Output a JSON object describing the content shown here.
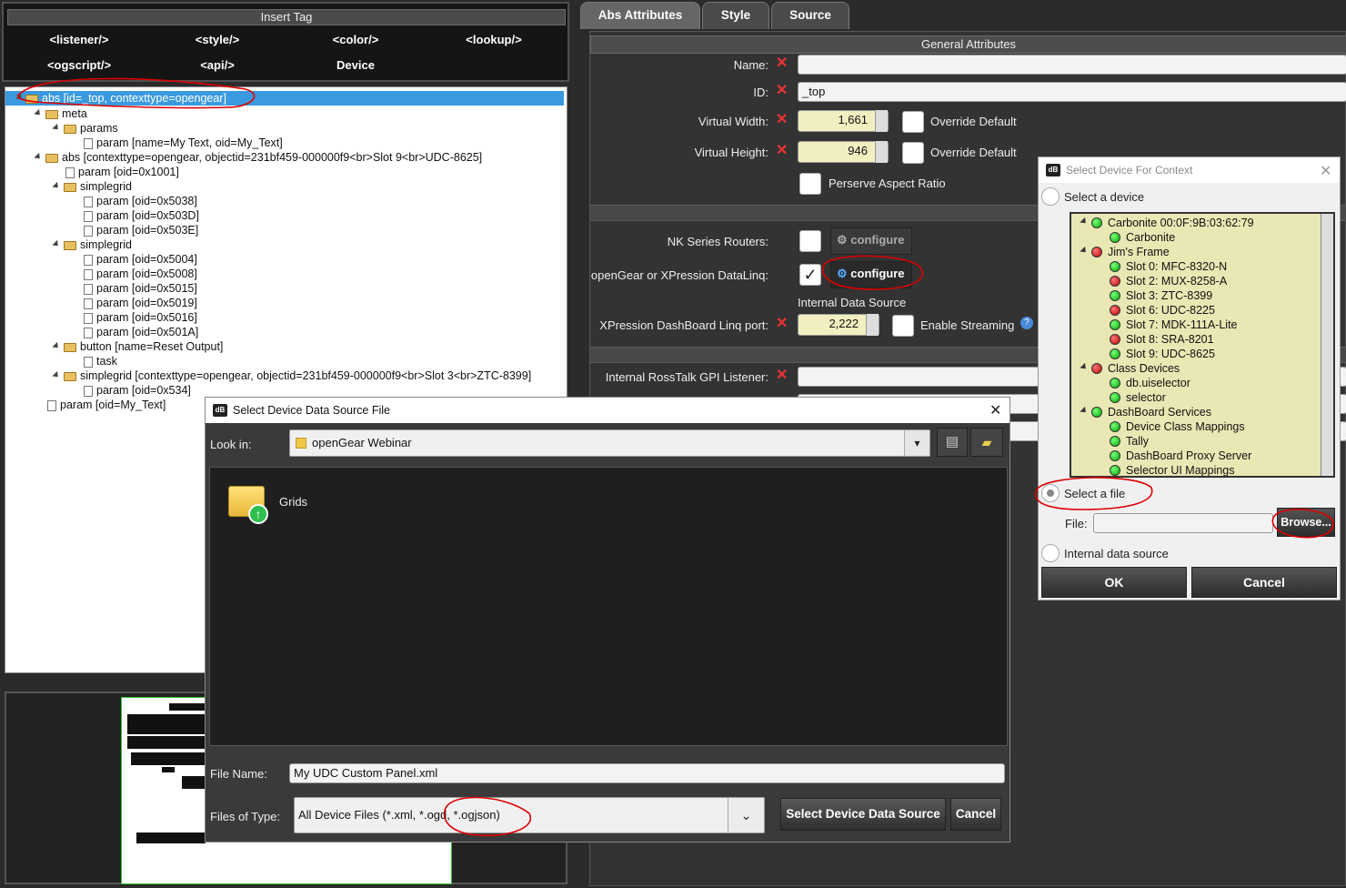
{
  "insert_tag": {
    "title": "Insert Tag",
    "buttons": [
      "<listener/>",
      "<style/>",
      "<color/>",
      "<lookup/>",
      "<ogscript/>",
      "<api/>",
      "Device"
    ]
  },
  "tree": {
    "nodes": [
      "abs [id=_top, contexttype=opengear]",
      "meta",
      "params",
      "param [name=My Text, oid=My_Text]",
      "abs [contexttype=opengear, objectid=231bf459-000000f9<br>Slot 9<br>UDC-8625]",
      "param [oid=0x1001]",
      "simplegrid",
      "param [oid=0x5038]",
      "param [oid=0x503D]",
      "param [oid=0x503E]",
      "simplegrid",
      "param [oid=0x5004]",
      "param [oid=0x5008]",
      "param [oid=0x5015]",
      "param [oid=0x5019]",
      "param [oid=0x5016]",
      "param [oid=0x501A]",
      "button [name=Reset Output]",
      "task",
      "simplegrid [contexttype=opengear, objectid=231bf459-000000f9<br>Slot 3<br>ZTC-8399]",
      "param [oid=0x534]",
      "param [oid=My_Text]"
    ]
  },
  "tabs": [
    "Abs Attributes",
    "Style",
    "Source"
  ],
  "general": {
    "title": "General Attributes",
    "name_label": "Name:",
    "name_value": "",
    "id_label": "ID:",
    "id_value": "_top",
    "vwidth_label": "Virtual Width:",
    "vwidth_value": "1,661",
    "vheight_label": "Virtual Height:",
    "vheight_value": "946",
    "override_label": "Override Default",
    "aspect_label": "Perserve Aspect Ratio",
    "nk_label": "NK Series Routers:",
    "configure": "configure",
    "datalinq_label": "openGear or XPression DataLinq:",
    "internal_source": "Internal Data Source",
    "xpression_label": "XPression DashBoard Linq port:",
    "xpression_value": "2,222",
    "streaming_label": "Enable Streaming",
    "rosstalk_label": "Internal RossTalk GPI Listener:"
  },
  "device_dialog": {
    "title": "Select Device For Context",
    "select_device": "Select a device",
    "devices": [
      {
        "label": "Carbonite 00:0F:9B:03:62:79",
        "status": "green"
      },
      {
        "label": "Carbonite",
        "status": "green"
      },
      {
        "label": "Jim's Frame",
        "status": "red"
      },
      {
        "label": "Slot 0: MFC-8320-N",
        "status": "green"
      },
      {
        "label": "Slot 2: MUX-8258-A",
        "status": "red"
      },
      {
        "label": "Slot 3: ZTC-8399",
        "status": "green"
      },
      {
        "label": "Slot 6: UDC-8225",
        "status": "red"
      },
      {
        "label": "Slot 7: MDK-111A-Lite",
        "status": "green"
      },
      {
        "label": "Slot 8: SRA-8201",
        "status": "red"
      },
      {
        "label": "Slot 9: UDC-8625",
        "status": "green"
      },
      {
        "label": "Class Devices",
        "status": "red"
      },
      {
        "label": "db.uiselector",
        "status": "green"
      },
      {
        "label": "selector",
        "status": "green"
      },
      {
        "label": "DashBoard Services",
        "status": "green"
      },
      {
        "label": "Device Class Mappings",
        "status": "green"
      },
      {
        "label": "Tally",
        "status": "green"
      },
      {
        "label": "DashBoard Proxy Server",
        "status": "green"
      },
      {
        "label": "Selector UI Mappings",
        "status": "green"
      }
    ],
    "select_file": "Select a file",
    "file_label": "File:",
    "file_value": "",
    "browse": "Browse...",
    "internal": "Internal data source",
    "ok": "OK",
    "cancel": "Cancel"
  },
  "file_dialog": {
    "title": "Select Device Data Source File",
    "look_in_label": "Look in:",
    "look_in_value": "openGear Webinar",
    "items": [
      {
        "name": "Grids",
        "icon": "folder-up-icon"
      }
    ],
    "file_name_label": "File Name:",
    "file_name_value": "My UDC Custom Panel.xml",
    "files_type_label": "Files of Type:",
    "files_type_value": "All Device Files (*.xml, *.ogd, *.ogjson)",
    "select_button": "Select Device Data Source",
    "cancel_button": "Cancel"
  },
  "colors": {
    "accent_red": "#e33",
    "status_green": "#0a0",
    "status_red": "#b00",
    "selection": "#3a9adf",
    "annotation": "#d00"
  }
}
